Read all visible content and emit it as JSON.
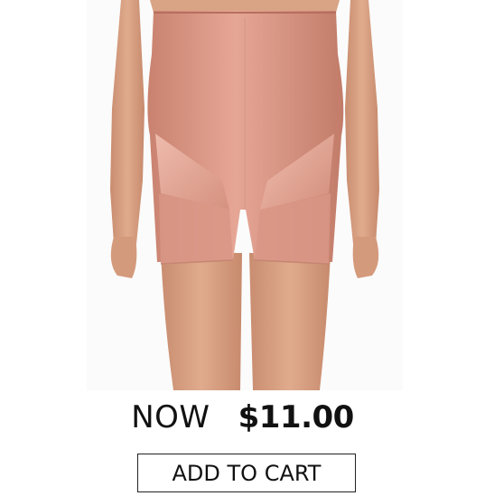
{
  "product": {
    "image_alt": "High-waist shaping shorts in rose pink",
    "image_tone": "#d99a86",
    "skin_tone": "#d8a184"
  },
  "price": {
    "prefix": "NOW",
    "value": "$11.00"
  },
  "cta": {
    "label": "ADD TO CART"
  }
}
